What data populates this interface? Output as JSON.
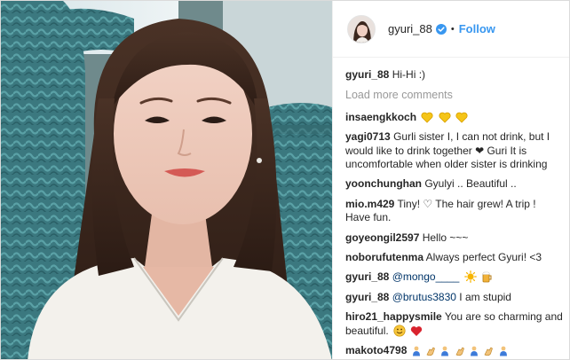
{
  "post": {
    "username": "gyuri_88",
    "follow_label": "Follow",
    "separator": "•",
    "icons": {
      "verified": "verified-badge-icon",
      "avatar": "avatar"
    }
  },
  "caption": {
    "user": "gyuri_88",
    "text": "Hi-Hi :)"
  },
  "load_more_label": "Load more comments",
  "comments": [
    {
      "user": "insaengkkoch",
      "text": "",
      "emoji": [
        "yellow-heart",
        "yellow-heart",
        "yellow-heart"
      ]
    },
    {
      "user": "yagi0713",
      "text": "Gurli sister I, I can not drink, but I would like to drink together ❤  Guri It is uncomfortable when older sister is drinking"
    },
    {
      "user": "yoonchunghan",
      "text": "Gyulyi .. Beautiful .."
    },
    {
      "user": "mio.m429",
      "text": "Tiny! ♡ The hair grew! A trip ! Have fun."
    },
    {
      "user": "goyeongil2597",
      "text": "Hello ~~~"
    },
    {
      "user": "noborufutenma",
      "text": "Always perfect Gyuri! <3"
    },
    {
      "user": "gyuri_88",
      "mention": "@mongo____",
      "text": "",
      "emoji": [
        "sun",
        "beer"
      ]
    },
    {
      "user": "gyuri_88",
      "mention": "@brutus3830",
      "text": "I am stupid"
    },
    {
      "user": "hiro21_happysmile",
      "text": "You are so charming and beautiful.",
      "emoji": [
        "smile",
        "red-heart"
      ]
    },
    {
      "user": "makoto4798",
      "text": "",
      "emoji": [
        "person",
        "clap",
        "person",
        "clap",
        "person",
        "clap",
        "person"
      ]
    }
  ],
  "colors": {
    "link_blue": "#3897f0",
    "mention_blue": "#003569",
    "muted": "#999999",
    "text": "#262626",
    "seat_teal": "#3f7f86"
  }
}
